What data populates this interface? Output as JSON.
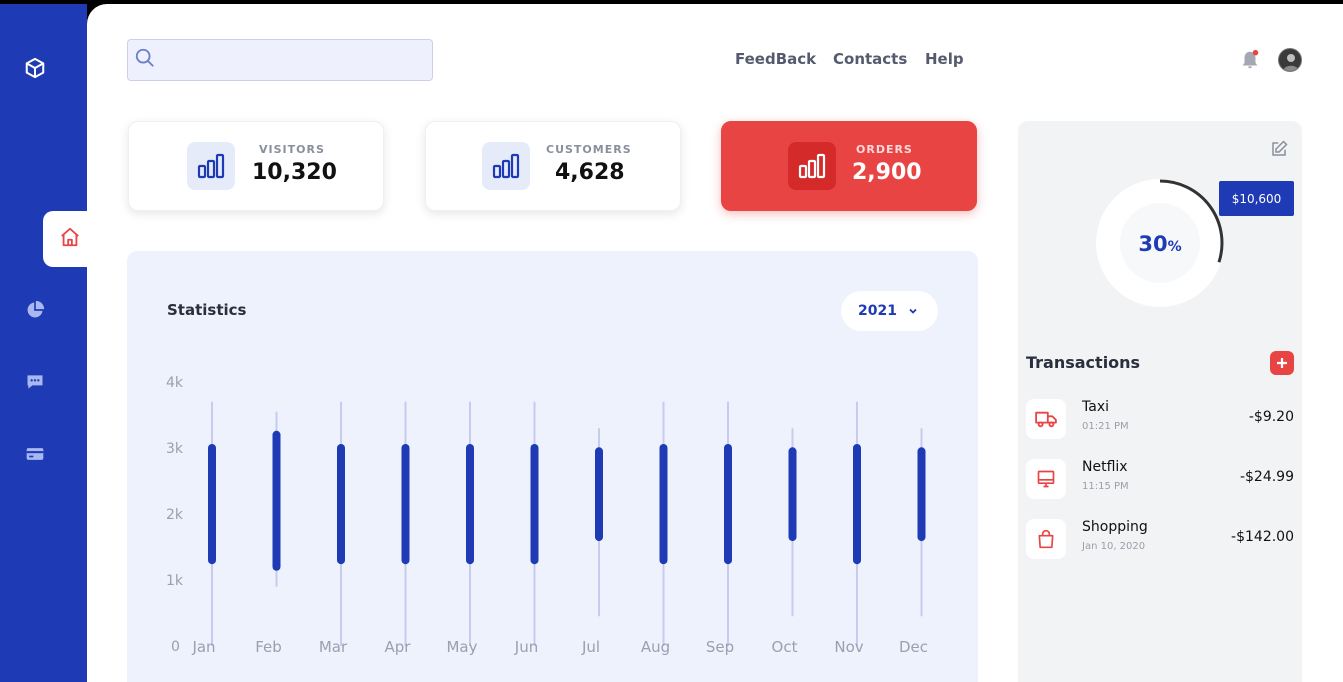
{
  "nav": {
    "feedback": "FeedBack",
    "contacts": "Contacts",
    "help": "Help"
  },
  "search": {
    "placeholder": ""
  },
  "cards": [
    {
      "label": "VISITORS",
      "value": "10,320"
    },
    {
      "label": "CUSTOMERS",
      "value": "4,628"
    },
    {
      "label": "ORDERS",
      "value": "2,900"
    }
  ],
  "statistics": {
    "title": "Statistics",
    "year": "2021"
  },
  "chart_data": {
    "type": "range-bar",
    "y_ticks": [
      "0",
      "1k",
      "2k",
      "3k",
      "4k"
    ],
    "ylim": [
      0,
      4000
    ],
    "categories": [
      "Jan",
      "Feb",
      "Mar",
      "Apr",
      "May",
      "Jun",
      "Jul",
      "Aug",
      "Sep",
      "Oct",
      "Nov",
      "Dec"
    ],
    "range_low": [
      1300,
      1200,
      1300,
      1300,
      1300,
      1300,
      1650,
      1300,
      1300,
      1650,
      1300,
      1650
    ],
    "range_high": [
      3000,
      3200,
      3000,
      3000,
      3000,
      3000,
      2950,
      3000,
      3000,
      2950,
      3000,
      2950
    ],
    "whisker_low": [
      0,
      900,
      0,
      0,
      0,
      0,
      450,
      0,
      0,
      450,
      0,
      450
    ],
    "whisker_high": [
      3700,
      3550,
      3700,
      3700,
      3700,
      3700,
      3300,
      3700,
      3700,
      3300,
      3700,
      3300
    ],
    "bar_color": "#1e3ab5",
    "whisker_color": "#c5ccef",
    "grid": false
  },
  "progress": {
    "percent": "30",
    "percent_sign": "%",
    "value": 30,
    "amount": "$10,600"
  },
  "transactions": {
    "title": "Transactions",
    "items": [
      {
        "name": "Taxi",
        "time": "01:21 PM",
        "amount": "-$9.20",
        "icon": "truck-icon"
      },
      {
        "name": "Netflix",
        "time": "11:15 PM",
        "amount": "-$24.99",
        "icon": "monitor-icon"
      },
      {
        "name": "Shopping",
        "time": "Jan 10, 2020",
        "amount": "-$142.00",
        "icon": "shopping-bag-icon"
      }
    ]
  },
  "colors": {
    "brand": "#1e3ab5",
    "accent": "#e94444",
    "panel": "#eef2fd"
  }
}
